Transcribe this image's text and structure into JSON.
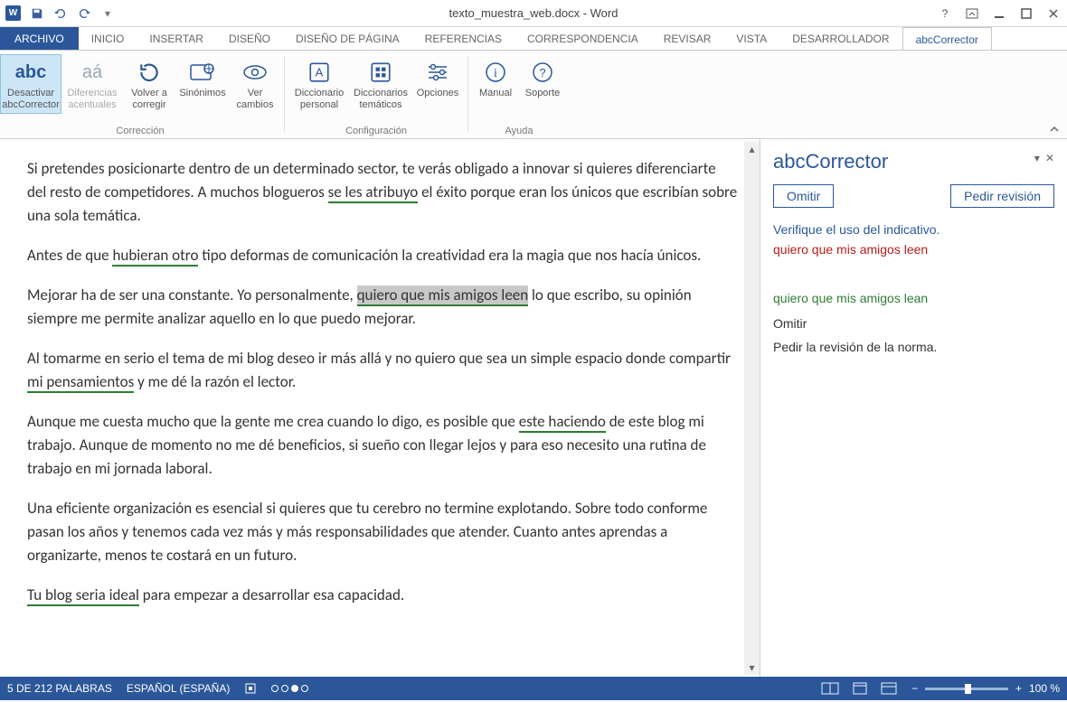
{
  "title": "texto_muestra_web.docx - Word",
  "menus": {
    "archivo": "ARCHIVO",
    "tabs": [
      "INICIO",
      "INSERTAR",
      "DISEÑO",
      "DISEÑO DE PÁGINA",
      "REFERENCIAS",
      "CORRESPONDENCIA",
      "REVISAR",
      "VISTA",
      "DESARROLLADOR",
      "abcCorrector"
    ],
    "active_index": 9
  },
  "ribbon": {
    "groups": [
      {
        "label": "Corrección",
        "items": [
          {
            "name": "desactivar",
            "label": "Desactivar abcCorrector",
            "icon": "abc",
            "active": true
          },
          {
            "name": "diferencias",
            "label": "Diferencias acentuales",
            "icon": "aa"
          },
          {
            "name": "volver",
            "label": "Volver a corregir",
            "icon": "refresh"
          },
          {
            "name": "sinonimos",
            "label": "Sinónimos",
            "icon": "book-globe"
          },
          {
            "name": "cambios",
            "label": "Ver cambios",
            "icon": "eye"
          }
        ]
      },
      {
        "label": "Configuración",
        "items": [
          {
            "name": "dicc-personal",
            "label": "Diccionario personal",
            "icon": "book-a"
          },
          {
            "name": "dicc-tematicos",
            "label": "Diccionarios temáticos",
            "icon": "book-grid"
          },
          {
            "name": "opciones",
            "label": "Opciones",
            "icon": "sliders"
          }
        ]
      },
      {
        "label": "Ayuda",
        "items": [
          {
            "name": "manual",
            "label": "Manual",
            "icon": "info"
          },
          {
            "name": "soporte",
            "label": "Soporte",
            "icon": "help"
          }
        ]
      }
    ]
  },
  "document": {
    "p1_a": "Si pretendes posicionarte dentro de un determinado sector, te verás obligado a innovar si quieres diferenciarte del resto de competidores.  A muchos blogueros ",
    "p1_err": "se les atribuyo",
    "p1_b": " el éxito porque eran los únicos que escribían sobre una sola temática.",
    "p2_a": " Antes de que ",
    "p2_err": "hubieran otro",
    "p2_b": " tipo deformas de comunicación la creatividad era la magia que nos hacía únicos.",
    "p3_a": "Mejorar ha de ser una constante. Yo personalmente,  ",
    "p3_err": "quiero que mis amigos leen",
    "p3_b": " lo que escribo, su opinión siempre me permite analizar aquello en lo que puedo mejorar.",
    "p4_a": "Al tomarme en serio el tema de mi blog  deseo ir más allá y no quiero que sea un simple espacio donde compartir ",
    "p4_err": "mi pensamientos",
    "p4_b": " y me dé la razón el lector.",
    "p5_a": "Aunque me cuesta mucho que la gente me crea cuando lo digo,  es posible que ",
    "p5_err": "este haciendo",
    "p5_b": " de este blog  mi trabajo. Aunque de momento no me dé beneficios, si sueño con llegar lejos y para eso necesito una rutina de trabajo en mi jornada laboral.",
    "p6": "Una eficiente organización es esencial si quieres que tu cerebro no termine explotando. Sobre todo conforme pasan los años y tenemos cada vez más y más responsabilidades que atender. Cuanto antes aprendas a organizarte, menos te costará en un futuro.",
    "p7_err": "Tu blog seria ideal",
    "p7_b": " para empezar a desarrollar esa capacidad."
  },
  "side": {
    "title": "abcCorrector",
    "omit_btn": "Omitir",
    "review_btn": "Pedir revisión",
    "verify": "Verifique el uso del indicativo.",
    "error_text": "quiero que mis amigos leen",
    "suggestion": "quiero que mis amigos lean",
    "omit_opt": "Omitir",
    "rule_opt": "Pedir la revisión de la norma."
  },
  "status": {
    "words": "5 DE 212 PALABRAS",
    "lang": "ESPAÑOL (ESPAÑA)",
    "zoom": "100 %"
  }
}
